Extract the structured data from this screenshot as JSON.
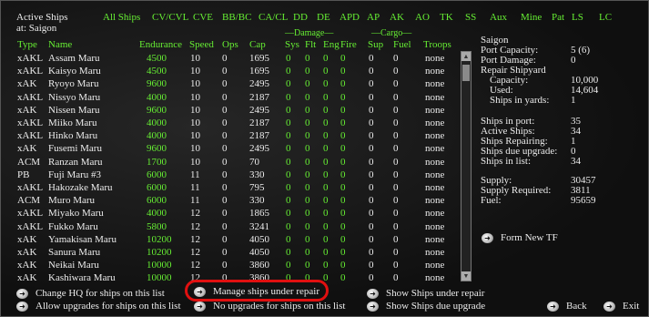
{
  "title": {
    "line1": "Active Ships",
    "line2": "at: Saigon"
  },
  "filters": [
    "All Ships",
    "CV/CVL",
    "CVE",
    "BB/BC",
    "CA/CL",
    "DD",
    "DE",
    "APD",
    "AP",
    "AK",
    "AO",
    "TK",
    "SS",
    "Aux",
    "Mine",
    "Pat",
    "LS",
    "LC"
  ],
  "columns": {
    "type": "Type",
    "name": "Name",
    "endurance": "Endurance",
    "speed": "Speed",
    "ops": "Ops",
    "cap": "Cap",
    "damage_group": "—Damage—",
    "sys": "Sys",
    "flt": "Flt",
    "eng": "Eng",
    "fire": "Fire",
    "cargo_group": "—Cargo—",
    "sup": "Sup",
    "fuel": "Fuel",
    "troops": "Troops"
  },
  "rows": [
    {
      "type": "xAKL",
      "name": "Assam Maru",
      "endurance": "4500",
      "speed": "10",
      "ops": "0",
      "cap": "1695",
      "sys": "0",
      "flt": "0",
      "eng": "0",
      "fire": "0",
      "sup": "0",
      "fuel": "0",
      "troops": "none"
    },
    {
      "type": "xAKL",
      "name": "Kaisyo Maru",
      "endurance": "4500",
      "speed": "10",
      "ops": "0",
      "cap": "1695",
      "sys": "0",
      "flt": "0",
      "eng": "0",
      "fire": "0",
      "sup": "0",
      "fuel": "0",
      "troops": "none"
    },
    {
      "type": "xAK",
      "name": "Ryoyo Maru",
      "endurance": "9600",
      "speed": "10",
      "ops": "0",
      "cap": "2495",
      "sys": "0",
      "flt": "0",
      "eng": "0",
      "fire": "0",
      "sup": "0",
      "fuel": "0",
      "troops": "none"
    },
    {
      "type": "xAKL",
      "name": "Nissyo Maru",
      "endurance": "4000",
      "speed": "10",
      "ops": "0",
      "cap": "2187",
      "sys": "0",
      "flt": "0",
      "eng": "0",
      "fire": "0",
      "sup": "0",
      "fuel": "0",
      "troops": "none"
    },
    {
      "type": "xAK",
      "name": "Nissen Maru",
      "endurance": "9600",
      "speed": "10",
      "ops": "0",
      "cap": "2495",
      "sys": "0",
      "flt": "0",
      "eng": "0",
      "fire": "0",
      "sup": "0",
      "fuel": "0",
      "troops": "none"
    },
    {
      "type": "xAKL",
      "name": "Miiko Maru",
      "endurance": "4000",
      "speed": "10",
      "ops": "0",
      "cap": "2187",
      "sys": "0",
      "flt": "0",
      "eng": "0",
      "fire": "0",
      "sup": "0",
      "fuel": "0",
      "troops": "none"
    },
    {
      "type": "xAKL",
      "name": "Hinko Maru",
      "endurance": "4000",
      "speed": "10",
      "ops": "0",
      "cap": "2187",
      "sys": "0",
      "flt": "0",
      "eng": "0",
      "fire": "0",
      "sup": "0",
      "fuel": "0",
      "troops": "none"
    },
    {
      "type": "xAK",
      "name": "Fusemi Maru",
      "endurance": "9600",
      "speed": "10",
      "ops": "0",
      "cap": "2495",
      "sys": "0",
      "flt": "0",
      "eng": "0",
      "fire": "0",
      "sup": "0",
      "fuel": "0",
      "troops": "none"
    },
    {
      "type": "ACM",
      "name": "Ranzan Maru",
      "endurance": "1700",
      "speed": "10",
      "ops": "0",
      "cap": "70",
      "sys": "0",
      "flt": "0",
      "eng": "0",
      "fire": "0",
      "sup": "0",
      "fuel": "0",
      "troops": "none"
    },
    {
      "type": "PB",
      "name": "Fuji Maru #3",
      "endurance": "6000",
      "speed": "11",
      "ops": "0",
      "cap": "330",
      "sys": "0",
      "flt": "0",
      "eng": "0",
      "fire": "0",
      "sup": "0",
      "fuel": "0",
      "troops": "none"
    },
    {
      "type": "xAKL",
      "name": "Hakozake Maru",
      "endurance": "6000",
      "speed": "11",
      "ops": "0",
      "cap": "795",
      "sys": "0",
      "flt": "0",
      "eng": "0",
      "fire": "0",
      "sup": "0",
      "fuel": "0",
      "troops": "none"
    },
    {
      "type": "ACM",
      "name": "Muro Maru",
      "endurance": "6000",
      "speed": "11",
      "ops": "0",
      "cap": "330",
      "sys": "0",
      "flt": "0",
      "eng": "0",
      "fire": "0",
      "sup": "0",
      "fuel": "0",
      "troops": "none"
    },
    {
      "type": "xAKL",
      "name": "Miyako Maru",
      "endurance": "4000",
      "speed": "12",
      "ops": "0",
      "cap": "1865",
      "sys": "0",
      "flt": "0",
      "eng": "0",
      "fire": "0",
      "sup": "0",
      "fuel": "0",
      "troops": "none"
    },
    {
      "type": "xAKL",
      "name": "Fukko Maru",
      "endurance": "5800",
      "speed": "12",
      "ops": "0",
      "cap": "3241",
      "sys": "0",
      "flt": "0",
      "eng": "0",
      "fire": "0",
      "sup": "0",
      "fuel": "0",
      "troops": "none"
    },
    {
      "type": "xAK",
      "name": "Yamakisan Maru",
      "endurance": "10200",
      "speed": "12",
      "ops": "0",
      "cap": "4050",
      "sys": "0",
      "flt": "0",
      "eng": "0",
      "fire": "0",
      "sup": "0",
      "fuel": "0",
      "troops": "none"
    },
    {
      "type": "xAK",
      "name": "Sanura Maru",
      "endurance": "10200",
      "speed": "12",
      "ops": "0",
      "cap": "4050",
      "sys": "0",
      "flt": "0",
      "eng": "0",
      "fire": "0",
      "sup": "0",
      "fuel": "0",
      "troops": "none"
    },
    {
      "type": "xAK",
      "name": "Neikai Maru",
      "endurance": "10000",
      "speed": "12",
      "ops": "0",
      "cap": "3860",
      "sys": "0",
      "flt": "0",
      "eng": "0",
      "fire": "0",
      "sup": "0",
      "fuel": "0",
      "troops": "none"
    },
    {
      "type": "xAK",
      "name": "Kashiwara Maru",
      "endurance": "10000",
      "speed": "12",
      "ops": "0",
      "cap": "3860",
      "sys": "0",
      "flt": "0",
      "eng": "0",
      "fire": "0",
      "sup": "0",
      "fuel": "0",
      "troops": "none"
    }
  ],
  "side": {
    "base": "Saigon",
    "port_capacity_label": "Port Capacity:",
    "port_capacity": "5 (6)",
    "port_damage_label": "Port Damage:",
    "port_damage": "0",
    "repair_shipyard_label": "Repair Shipyard",
    "capacity_label": "Capacity:",
    "capacity": "10,000",
    "used_label": "Used:",
    "used": "14,604",
    "ships_in_yards_label": "Ships in yards:",
    "ships_in_yards": "1",
    "ships_in_port_label": "Ships in port:",
    "ships_in_port": "35",
    "active_ships_label": "Active Ships:",
    "active_ships": "34",
    "ships_repairing_label": "Ships Repairing:",
    "ships_repairing": "1",
    "ships_due_upgrade_label": "Ships due upgrade:",
    "ships_due_upgrade": "0",
    "ships_in_list_label": "Ships in list:",
    "ships_in_list": "34",
    "supply_label": "Supply:",
    "supply": "30457",
    "supply_required_label": "Supply Required:",
    "supply_required": "3811",
    "fuel_label": "Fuel:",
    "fuel": "95659",
    "form_new_tf": "Form New TF"
  },
  "buttons": {
    "change_hq": "Change HQ for ships on this list",
    "allow_upgrades": "Allow upgrades for ships on this list",
    "manage_repair": "Manage ships under repair",
    "no_upgrades": "No upgrades for ships on this list",
    "show_repair": "Show Ships under repair",
    "show_upgrade": "Show Ships due upgrade",
    "back": "Back",
    "exit": "Exit"
  },
  "colors": {
    "accent_green": "#66ee33",
    "highlight_red": "#e01010"
  }
}
